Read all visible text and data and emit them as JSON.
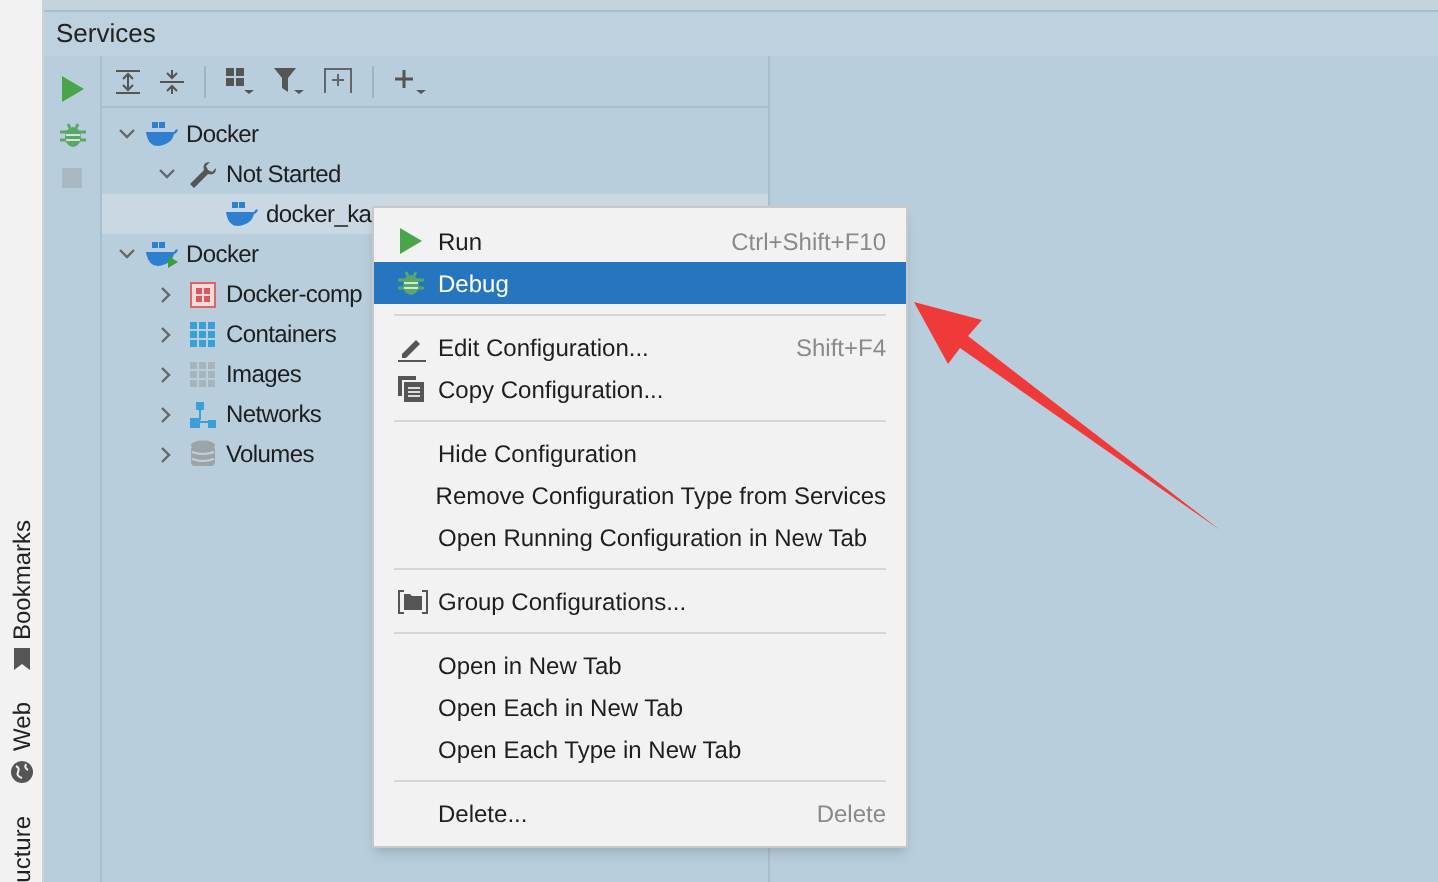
{
  "panel": {
    "title": "Services"
  },
  "side_tools": [
    {
      "label": "Bookmarks"
    },
    {
      "label": "Web"
    },
    {
      "label": "ucture"
    }
  ],
  "tree": [
    {
      "label": "Docker",
      "kind": "docker",
      "expanded": true,
      "selected": false,
      "children": [
        {
          "label": "Not Started",
          "kind": "group",
          "expanded": true,
          "selected": false,
          "children": [
            {
              "label": "docker_ka",
              "kind": "docker",
              "selected": true
            }
          ]
        }
      ]
    },
    {
      "label": "Docker",
      "kind": "connection",
      "expanded": true,
      "selected": false,
      "children": [
        {
          "label": "Docker-comp",
          "kind": "compose",
          "expanded": false,
          "selected": false
        },
        {
          "label": "Containers",
          "kind": "containers",
          "expanded": false,
          "selected": false
        },
        {
          "label": "Images",
          "kind": "images",
          "expanded": false,
          "selected": false
        },
        {
          "label": "Networks",
          "kind": "networks",
          "expanded": false,
          "selected": false
        },
        {
          "label": "Volumes",
          "kind": "volumes",
          "expanded": false,
          "selected": false
        }
      ]
    }
  ],
  "context_menu": [
    {
      "kind": "run",
      "label": "Run",
      "shortcut": "Ctrl+Shift+F10",
      "selected": false
    },
    {
      "kind": "debug",
      "label": "Debug",
      "selected": true
    },
    {
      "kind": "separator"
    },
    {
      "kind": "edit",
      "label": "Edit Configuration...",
      "shortcut": "Shift+F4",
      "selected": false
    },
    {
      "kind": "copy",
      "label": "Copy Configuration...",
      "selected": false
    },
    {
      "kind": "separator"
    },
    {
      "kind": "item",
      "label": "Hide Configuration",
      "selected": false
    },
    {
      "kind": "item",
      "label": "Remove Configuration Type from Services",
      "selected": false
    },
    {
      "kind": "item",
      "label": "Open Running Configuration in New Tab",
      "selected": false
    },
    {
      "kind": "separator"
    },
    {
      "kind": "folder",
      "label": "Group Configurations...",
      "selected": false
    },
    {
      "kind": "separator"
    },
    {
      "kind": "item",
      "label": "Open in New Tab",
      "selected": false
    },
    {
      "kind": "item",
      "label": "Open Each in New Tab",
      "selected": false
    },
    {
      "kind": "item",
      "label": "Open Each Type in New Tab",
      "selected": false
    },
    {
      "kind": "separator"
    },
    {
      "kind": "item",
      "label": "Delete...",
      "shortcut": "Delete",
      "selected": false
    }
  ]
}
